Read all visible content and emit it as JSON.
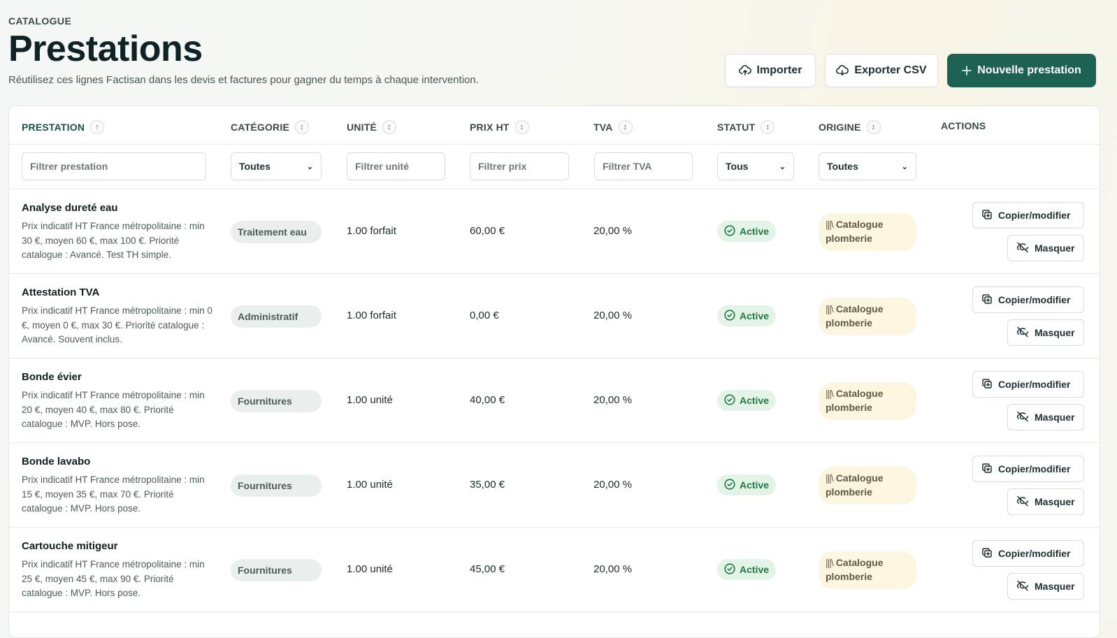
{
  "header": {
    "eyebrow": "CATALOGUE",
    "title": "Prestations",
    "subtitle": "Réutilisez ces lignes Factisan dans les devis et factures pour gagner du temps à chaque intervention.",
    "buttons": {
      "import": "Importer",
      "export": "Exporter CSV",
      "new": "Nouvelle prestation"
    }
  },
  "colors": {
    "accent": "#1c6152",
    "active_status": "#1f7a40",
    "origin_bg": "#fcf5df"
  },
  "table": {
    "columns": [
      {
        "label": "PRESTATION",
        "sort": "↑"
      },
      {
        "label": "CATÉGORIE",
        "sort": "↕"
      },
      {
        "label": "UNITÉ",
        "sort": "↕"
      },
      {
        "label": "PRIX HT",
        "sort": "↕"
      },
      {
        "label": "TVA",
        "sort": "↕"
      },
      {
        "label": "STATUT",
        "sort": "↕"
      },
      {
        "label": "ORIGINE",
        "sort": "↕"
      },
      {
        "label": "ACTIONS"
      }
    ],
    "filters": {
      "prestation_placeholder": "Filtrer prestation",
      "categorie_value": "Toutes",
      "unite_placeholder": "Filtrer unité",
      "prix_placeholder": "Filtrer prix",
      "tva_placeholder": "Filtrer TVA",
      "statut_value": "Tous",
      "origine_value": "Toutes"
    },
    "action_labels": {
      "copy": "Copier/modifier",
      "hide": "Masquer"
    },
    "rows": [
      {
        "name": "Analyse dureté eau",
        "description": "Prix indicatif HT France métropolitaine : min 30 €, moyen 60 €, max 100 €. Priorité catalogue : Avancé. Test TH simple.",
        "category": "Traitement eau",
        "unit": "1.00 forfait",
        "price": "60,00 €",
        "tva": "20,00 %",
        "status": "Active",
        "origin_icon": "|||\\",
        "origin": "Catalogue plomberie"
      },
      {
        "name": "Attestation TVA",
        "description": "Prix indicatif HT France métropolitaine : min 0 €, moyen 0 €, max 30 €. Priorité catalogue : Avancé. Souvent inclus.",
        "category": "Administratif",
        "unit": "1.00 forfait",
        "price": "0,00 €",
        "tva": "20,00 %",
        "status": "Active",
        "origin_icon": "|||\\",
        "origin": "Catalogue plomberie"
      },
      {
        "name": "Bonde évier",
        "description": "Prix indicatif HT France métropolitaine : min 20 €, moyen 40 €, max 80 €. Priorité catalogue : MVP. Hors pose.",
        "category": "Fournitures",
        "unit": "1.00 unité",
        "price": "40,00 €",
        "tva": "20,00 %",
        "status": "Active",
        "origin_icon": "|||\\",
        "origin": "Catalogue plomberie"
      },
      {
        "name": "Bonde lavabo",
        "description": "Prix indicatif HT France métropolitaine : min 15 €, moyen 35 €, max 70 €. Priorité catalogue : MVP. Hors pose.",
        "category": "Fournitures",
        "unit": "1.00 unité",
        "price": "35,00 €",
        "tva": "20,00 %",
        "status": "Active",
        "origin_icon": "|||\\",
        "origin": "Catalogue plomberie"
      },
      {
        "name": "Cartouche mitigeur",
        "description": "Prix indicatif HT France métropolitaine : min 25 €, moyen 45 €, max 90 €. Priorité catalogue : MVP. Hors pose.",
        "category": "Fournitures",
        "unit": "1.00 unité",
        "price": "45,00 €",
        "tva": "20,00 %",
        "status": "Active",
        "origin_icon": "|||\\",
        "origin": "Catalogue plomberie"
      }
    ]
  }
}
